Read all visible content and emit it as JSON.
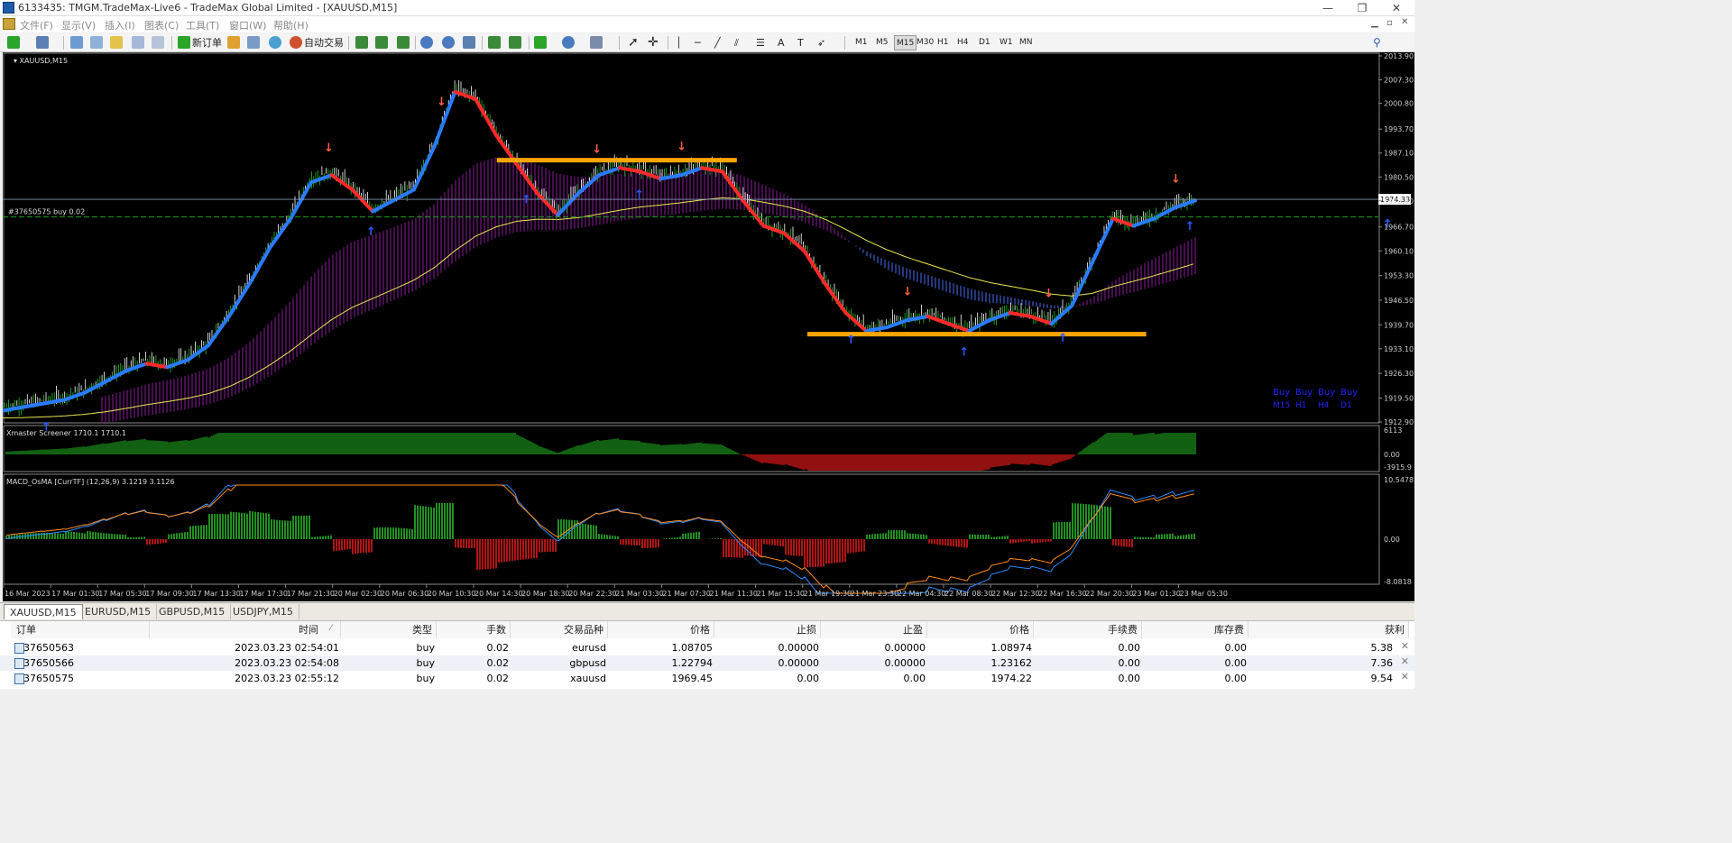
{
  "window": {
    "title": "6133435: TMGM.TradeMax-Live6 - TradeMax Global Limited - [XAUUSD,M15]",
    "controls": [
      "—",
      "❐",
      "✕"
    ]
  },
  "menu": [
    "文件(F)",
    "显示(V)",
    "插入(I)",
    "图表(C)",
    "工具(T)",
    "窗口(W)",
    "帮助(H)"
  ],
  "toolbar": {
    "new_order": "新订单",
    "auto_trade": "自动交易",
    "notifications": "5",
    "timeframes": [
      "M1",
      "M5",
      "M15",
      "M30",
      "H1",
      "H4",
      "D1",
      "W1",
      "MN"
    ],
    "active_timeframe": "M15"
  },
  "chart_data": {
    "type": "candlestick",
    "title": "XAUUSD,M15",
    "order_line": {
      "label": "#37650575 buy 0.02",
      "price": 1969.45
    },
    "current_price": "1974.33",
    "y_ticks": [
      "2013.90",
      "2007.30",
      "2000.80",
      "1993.70",
      "1987.10",
      "1980.50",
      "1973.90",
      "1966.70",
      "1960.10",
      "1953.30",
      "1946.50",
      "1939.70",
      "1933.10",
      "1926.30",
      "1919.50",
      "1912.90"
    ],
    "x_ticks": [
      "16 Mar 2023",
      "17 Mar 01:30",
      "17 Mar 05:30",
      "17 Mar 09:30",
      "17 Mar 13:30",
      "17 Mar 17:30",
      "17 Mar 21:30",
      "20 Mar 02:30",
      "20 Mar 06:30",
      "20 Mar 10:30",
      "20 Mar 14:30",
      "20 Mar 18:30",
      "20 Mar 22:30",
      "21 Mar 03:30",
      "21 Mar 07:30",
      "21 Mar 11:30",
      "21 Mar 15:30",
      "21 Mar 19:30",
      "21 Mar 23:30",
      "22 Mar 04:30",
      "22 Mar 08:30",
      "22 Mar 12:30",
      "22 Mar 16:30",
      "22 Mar 20:30",
      "23 Mar 01:30",
      "23 Mar 05:30"
    ],
    "close_path": [
      1917,
      1918,
      1919,
      1920,
      1922,
      1925,
      1928,
      1930,
      1929,
      1931,
      1935,
      1943,
      1952,
      1962,
      1970,
      1980,
      1982,
      1978,
      1972,
      1975,
      1978,
      1990,
      2005,
      2003,
      1993,
      1985,
      1977,
      1971,
      1977,
      1982,
      1984,
      1983,
      1981,
      1982,
      1984,
      1983,
      1975,
      1968,
      1966,
      1961,
      1952,
      1944,
      1939,
      1940,
      1942,
      1943,
      1941,
      1939,
      1942,
      1944,
      1943,
      1941,
      1946,
      1958,
      1970,
      1968,
      1970,
      1973,
      1975
    ],
    "signals_up_x": [
      0.03,
      0.26,
      0.37,
      0.45,
      0.6,
      0.68,
      0.75,
      0.84,
      0.98
    ],
    "signals_down_x": [
      0.23,
      0.31,
      0.42,
      0.48,
      0.64,
      0.74,
      0.83
    ],
    "support_zone": {
      "x": [
        0.57,
        0.81
      ],
      "price": 1937
    },
    "resistance_zone": {
      "x": [
        0.35,
        0.52
      ],
      "price": 1985
    },
    "signal_panel": {
      "labels": [
        "Buy",
        "Buy",
        "Buy",
        "Buy"
      ],
      "timeframes": [
        "M15",
        "H1",
        "H4",
        "D1"
      ]
    },
    "indicator1": {
      "title": "Xmaster Screener 1710.1 1710.1",
      "y_ticks": [
        "6113",
        "0.00",
        "-3915.9"
      ]
    },
    "indicator2": {
      "title": "MACD_OsMA [CurrTF] (12,26,9) 3.1219 3.1126",
      "y_ticks": [
        "10.5478",
        "0.00",
        "-8.0818"
      ]
    },
    "colors": {
      "bull": "#22c022",
      "bear": "#e02020",
      "trend_up": "#2a7bff",
      "trend_down": "#ff2a2a",
      "ma_yellow": "#e8e850",
      "cloud_purple": "#8b1e9a",
      "cloud_blue": "#4a6cf0",
      "zone": "#ffa500"
    }
  },
  "tabs": [
    "XAUUSD,M15",
    "EURUSD,M15",
    "GBPUSD,M15",
    "USDJPY,M15"
  ],
  "terminal": {
    "headers": [
      "订单",
      "时间",
      "类型",
      "手数",
      "交易品种",
      "价格",
      "止损",
      "止盈",
      "价格",
      "手续费",
      "库存费",
      "获利"
    ],
    "rows": [
      {
        "order": "37650563",
        "time": "2023.03.23 02:54:01",
        "type": "buy",
        "lots": "0.02",
        "symbol": "eurusd",
        "price": "1.08705",
        "sl": "0.00000",
        "tp": "0.00000",
        "cur": "1.08974",
        "comm": "0.00",
        "swap": "0.00",
        "profit": "5.38"
      },
      {
        "order": "37650566",
        "time": "2023.03.23 02:54:08",
        "type": "buy",
        "lots": "0.02",
        "symbol": "gbpusd",
        "price": "1.22794",
        "sl": "0.00000",
        "tp": "0.00000",
        "cur": "1.23162",
        "comm": "0.00",
        "swap": "0.00",
        "profit": "7.36"
      },
      {
        "order": "37650575",
        "time": "2023.03.23 02:55:12",
        "type": "buy",
        "lots": "0.02",
        "symbol": "xauusd",
        "price": "1969.45",
        "sl": "0.00",
        "tp": "0.00",
        "cur": "1974.22",
        "comm": "0.00",
        "swap": "0.00",
        "profit": "9.54"
      }
    ]
  }
}
